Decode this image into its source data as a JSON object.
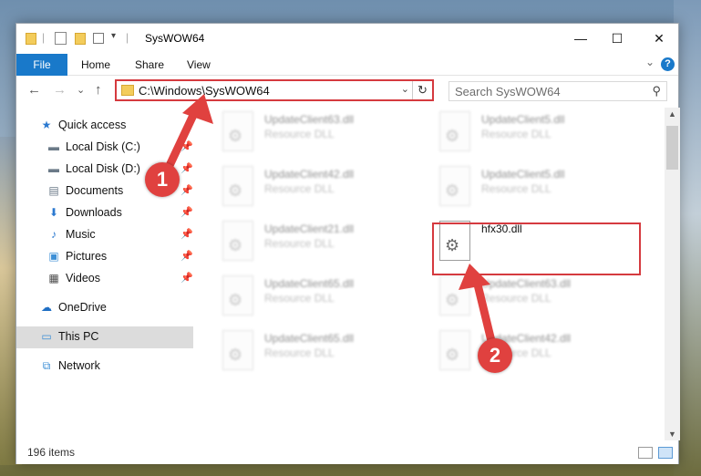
{
  "window": {
    "title": "SysWOW64",
    "min_glyph": "—",
    "max_glyph": "☐",
    "close_glyph": "✕"
  },
  "ribbon": {
    "file_tab": "File",
    "tabs": [
      "Home",
      "Share",
      "View"
    ],
    "help_glyph": "?",
    "collapse_glyph": "⌄"
  },
  "nav": {
    "back_glyph": "←",
    "forward_glyph": "→",
    "recent_glyph": "⌄",
    "up_glyph": "↑",
    "address": "C:\\Windows\\SysWOW64",
    "address_dropdown_glyph": "⌄",
    "refresh_glyph": "↻",
    "search_placeholder": "Search SysWOW64",
    "search_glyph": "⚲"
  },
  "sidebar": {
    "pin_glyph": "📌",
    "items": [
      {
        "label": "Quick access",
        "icon": "star-icon",
        "glyph": "★",
        "color": "#2b79d0",
        "pinned": false
      },
      {
        "label": "Local Disk (C:)",
        "icon": "drive-icon",
        "glyph": "▬",
        "color": "#6b7a88",
        "pinned": true
      },
      {
        "label": "Local Disk (D:)",
        "icon": "drive-icon",
        "glyph": "▬",
        "color": "#6b7a88",
        "pinned": true
      },
      {
        "label": "Documents",
        "icon": "documents-icon",
        "glyph": "▤",
        "color": "#6b7a88",
        "pinned": true
      },
      {
        "label": "Downloads",
        "icon": "download-icon",
        "glyph": "⬇",
        "color": "#2b79d0",
        "pinned": true
      },
      {
        "label": "Music",
        "icon": "music-icon",
        "glyph": "♪",
        "color": "#2b79d0",
        "pinned": true
      },
      {
        "label": "Pictures",
        "icon": "pictures-icon",
        "glyph": "▣",
        "color": "#3d8fd6",
        "pinned": true
      },
      {
        "label": "Videos",
        "icon": "videos-icon",
        "glyph": "▦",
        "color": "#4a4a4a",
        "pinned": true
      },
      {
        "label": "OneDrive",
        "icon": "cloud-icon",
        "glyph": "☁",
        "color": "#1f6fc4",
        "pinned": false
      },
      {
        "label": "This PC",
        "icon": "computer-icon",
        "glyph": "▭",
        "color": "#3d8fd6",
        "pinned": false,
        "selected": true
      },
      {
        "label": "Network",
        "icon": "network-icon",
        "glyph": "⧉",
        "color": "#3d8fd6",
        "pinned": false
      }
    ]
  },
  "files": [
    {
      "name": "UpdateClient63.dll",
      "type": "Resource DLL",
      "blurred": true
    },
    {
      "name": "UpdateClient5.dll",
      "type": "Resource DLL",
      "blurred": true
    },
    {
      "name": "UpdateClient42.dll",
      "type": "Resource DLL",
      "blurred": true
    },
    {
      "name": "UpdateClient5.dll",
      "type": "Resource DLL",
      "blurred": true
    },
    {
      "name": "UpdateClient21.dll",
      "type": "Resource DLL",
      "blurred": true
    },
    {
      "name": "hfx30.dll",
      "type": "",
      "blurred": false
    },
    {
      "name": "UpdateClient65.dll",
      "type": "Resource DLL",
      "blurred": true
    },
    {
      "name": "UpdateClient63.dll",
      "type": "Resource DLL",
      "blurred": true
    },
    {
      "name": "UpdateClient65.dll",
      "type": "Resource DLL",
      "blurred": true
    },
    {
      "name": "UpdateClient42.dll",
      "type": "Resource DLL",
      "blurred": true
    }
  ],
  "gear_glyph": "⚙",
  "status": {
    "item_count": "196 items"
  },
  "annotations": {
    "step1": "1",
    "step2": "2",
    "color": "#e0413f"
  },
  "scroll": {
    "up_glyph": "▲",
    "down_glyph": "▼"
  }
}
